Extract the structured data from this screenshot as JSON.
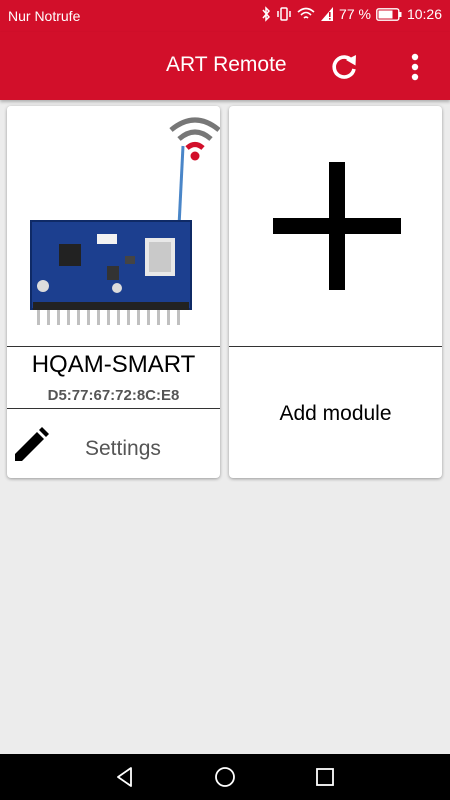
{
  "status_bar": {
    "carrier": "Nur Notrufe",
    "battery": "77 %",
    "time": "10:26"
  },
  "app_bar": {
    "title": "ART Remote",
    "icons": [
      "refresh-icon",
      "more-vert-icon"
    ]
  },
  "modules": [
    {
      "name": "HQAM-SMART",
      "mac": "D5:77:67:72:8C:E8",
      "settings_label": "Settings",
      "icons": [
        "wifi-signal-icon",
        "pencil-icon"
      ]
    }
  ],
  "add_card": {
    "label": "Add module",
    "icon": "plus-icon"
  },
  "navigation": {
    "icons": [
      "back-icon",
      "home-icon",
      "recents-icon"
    ]
  },
  "colors": {
    "primary": "#d20f2a",
    "background": "#ececec",
    "card": "#ffffff"
  }
}
